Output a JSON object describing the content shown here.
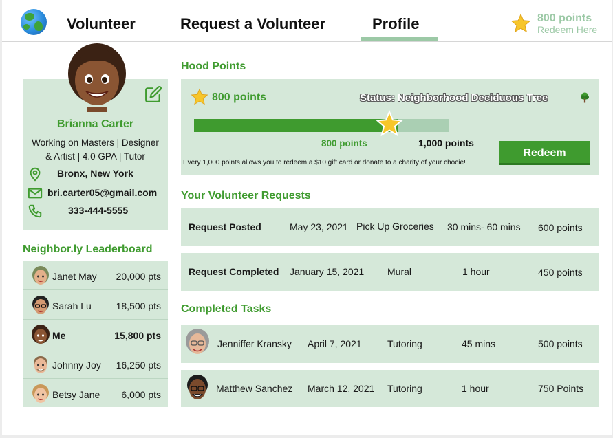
{
  "nav": {
    "links": [
      "Volunteer",
      "Request a Volunteer",
      "Profile"
    ],
    "points": "800 points",
    "redeem": "Redeem Here"
  },
  "profile": {
    "name": "Brianna Carter",
    "bio_line1": "Working on Masters | Designer",
    "bio_line2": "& Artist | 4.0 GPA | Tutor",
    "location": "Bronx, New York",
    "email": "bri.carter05@gmail.com",
    "phone": "333-444-5555"
  },
  "leaderboard": {
    "title": "Neighbor.ly Leaderboard",
    "rows": [
      {
        "name": "Janet May",
        "points": "20,000 pts"
      },
      {
        "name": "Sarah Lu",
        "points": "18,500 pts"
      },
      {
        "name": "Me",
        "points": "15,800 pts"
      },
      {
        "name": "Johnny Joy",
        "points": "16,250 pts"
      },
      {
        "name": "Betsy Jane",
        "points": "6,000 pts"
      }
    ]
  },
  "hood": {
    "title": "Hood Points",
    "points": "800 points",
    "status": "Status: Neighborhood Deciduous Tree",
    "current_label": "800 points",
    "max_label": "1,000 points",
    "progress": 0.8,
    "note": "Every 1,000 points allows you to redeem a $10 gift card or donate to a charity of your chocie!",
    "redeem_label": "Redeem"
  },
  "requests": {
    "title": "Your Volunteer Requests",
    "rows": [
      {
        "status": "Request Posted",
        "date": "May 23, 2021",
        "task": "Pick Up Groceries",
        "duration": "30 mins- 60 mins",
        "points": "600 points"
      },
      {
        "status": "Request Completed",
        "date": "January 15, 2021",
        "task": "Mural",
        "duration": "1 hour",
        "points": "450 points"
      }
    ]
  },
  "completed": {
    "title": "Completed Tasks",
    "rows": [
      {
        "name": "Jenniffer Kransky",
        "date": "April 7, 2021",
        "task": "Tutoring",
        "duration": "45 mins",
        "points": "500 points"
      },
      {
        "name": "Matthew Sanchez",
        "date": "March 12, 2021",
        "task": "Tutoring",
        "duration": "1 hour",
        "points": "750 Points"
      }
    ]
  },
  "colors": {
    "accent_green": "#3f9b2f",
    "card_bg": "#d5e8d9",
    "muted_green": "#9cc9a6"
  },
  "icons": [
    "globe-logo-icon",
    "star-icon",
    "edit-icon",
    "location-pin-icon",
    "mail-icon",
    "phone-icon",
    "tree-icon"
  ]
}
